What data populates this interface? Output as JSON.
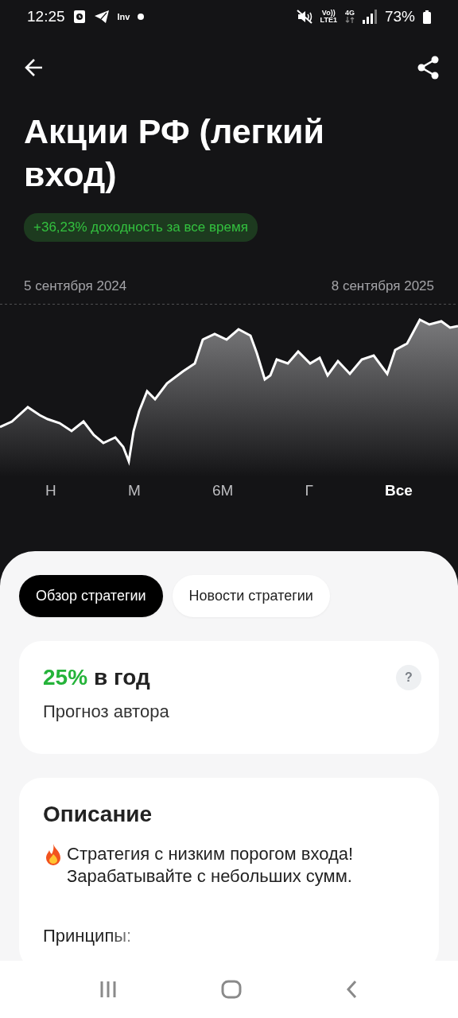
{
  "status_bar": {
    "time": "12:25",
    "app_label": "Inv",
    "volte": "Vo))",
    "volte_line": "LTE1",
    "network": "4G",
    "battery": "73%"
  },
  "title": "Акции РФ (легкий вход)",
  "return_badge": "+36,23% доходность за все время",
  "chart": {
    "start_date": "5 сентября 2024",
    "end_date": "8 сентября 2025",
    "kind": "picture"
  },
  "periods": [
    {
      "label": "Н",
      "selected": false
    },
    {
      "label": "М",
      "selected": false
    },
    {
      "label": "6М",
      "selected": false
    },
    {
      "label": "Г",
      "selected": false
    },
    {
      "label": "Все",
      "selected": true
    }
  ],
  "tabs": [
    {
      "label": "Обзор стратегии",
      "selected": true
    },
    {
      "label": "Новости стратегии",
      "selected": false
    }
  ],
  "forecast": {
    "value": "25%",
    "unit": "в год",
    "caption": "Прогноз автора",
    "help": "?"
  },
  "description": {
    "heading": "Описание",
    "text": "Стратегия с низким порогом входа! Зарабатывайте с небольших сумм.",
    "subheading": "Принципы:"
  }
}
